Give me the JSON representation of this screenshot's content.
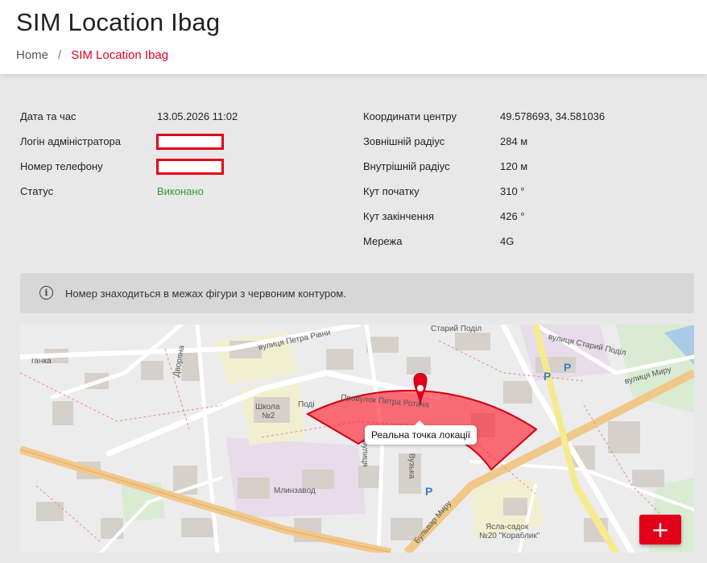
{
  "header": {
    "title": "SIM Location Ibag",
    "breadcrumb": {
      "home": "Home",
      "separator": "/",
      "current": "SIM Location Ibag"
    }
  },
  "details_left": [
    {
      "label": "Дата та час",
      "value": "13.05.2026 11:02"
    },
    {
      "label": "Логін адміністратора",
      "value": ""
    },
    {
      "label": "Номер телефону",
      "value": ""
    },
    {
      "label": "Статус",
      "value": "Виконано"
    }
  ],
  "details_right": [
    {
      "label": "Координати центру",
      "value": "49.578693, 34.581036"
    },
    {
      "label": "Зовнішній радіус",
      "value": "284 м"
    },
    {
      "label": "Внутрішній радіус",
      "value": "120 м"
    },
    {
      "label": "Кут початку",
      "value": "310 °"
    },
    {
      "label": "Кут закінчення",
      "value": "426 °"
    },
    {
      "label": "Мережа",
      "value": "4G"
    }
  ],
  "alert": {
    "icon": "info-icon",
    "text": "Номер знаходиться в межах фігури з червоним контуром."
  },
  "map": {
    "tooltip": "Реальна точка локації",
    "labels": {
      "petra_ryvny": "вулиця Петра Рівни",
      "petra_rotach": "Провулок Петра Ротача",
      "stary_podil": "вулиця Старий Поділ",
      "starii_podil2": "Старий Поділ",
      "myru": "вулиця Миру",
      "bulvar_myru": "Бульвар Миру",
      "school": "Школа",
      "school_num": "№2",
      "mlynzavod": "Млинзавод",
      "podil": "Поді",
      "kindergarten": "Ясла-садок",
      "kindergarten_name": "№20 \"Кораблик\"",
      "parking": "P",
      "ganka": "ганка",
      "vuzka": "Вузька",
      "vulytsia": "вулиця",
      "dvirna": "Дворяна"
    },
    "zoom_in": "+"
  },
  "colors": {
    "accent": "#e3001b",
    "success": "#2e9b3a"
  }
}
